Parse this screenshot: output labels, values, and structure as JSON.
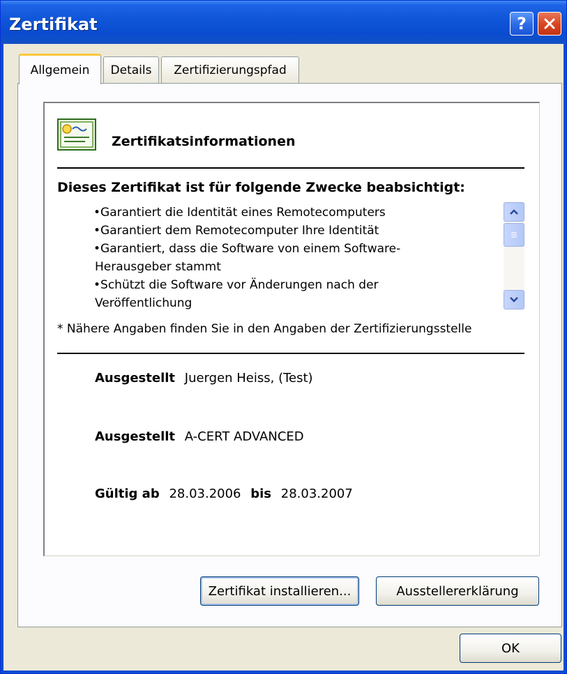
{
  "window": {
    "title": "Zertifikat",
    "help_label": "?"
  },
  "tabs": [
    {
      "label": "Allgemein",
      "active": true
    },
    {
      "label": "Details",
      "active": false
    },
    {
      "label": "Zertifizierungspfad",
      "active": false
    }
  ],
  "certificate": {
    "heading": "Zertifikatsinformationen",
    "purpose_heading": "Dieses Zertifikat ist für folgende Zwecke beabsichtigt:",
    "purposes": [
      "•Garantiert die Identität eines Remotecomputers",
      "•Garantiert dem Remotecomputer Ihre Identität",
      "•Garantiert, dass die Software von einem Software-",
      "Herausgeber stammt",
      "•Schützt die Software vor Änderungen nach der",
      "Veröffentlichung"
    ],
    "note": "* Nähere Angaben finden Sie in den Angaben der Zertifizierungsstelle",
    "issued_to_label": "Ausgestellt",
    "issued_to_value": "Juergen Heiss,  (Test)",
    "issued_by_label": "Ausgestellt",
    "issued_by_value": "A-CERT ADVANCED",
    "valid_from_label": "Gültig ab",
    "valid_from_value": "28.03.2006",
    "valid_to_label": "bis",
    "valid_to_value": "28.03.2007"
  },
  "buttons": {
    "install": "Zertifikat installieren...",
    "issuer_statement": "Ausstellererklärung",
    "ok": "OK"
  },
  "icons": {
    "certificate": "certificate-icon",
    "help": "help-icon",
    "close": "close-icon",
    "scroll_up": "chevron-up-icon",
    "scroll_down": "chevron-down-icon"
  },
  "colors": {
    "titlebar": "#0a4cd0",
    "close_button": "#d8431f",
    "active_tab_accent": "#ffc83c",
    "dialog_background": "#ece9d8"
  }
}
